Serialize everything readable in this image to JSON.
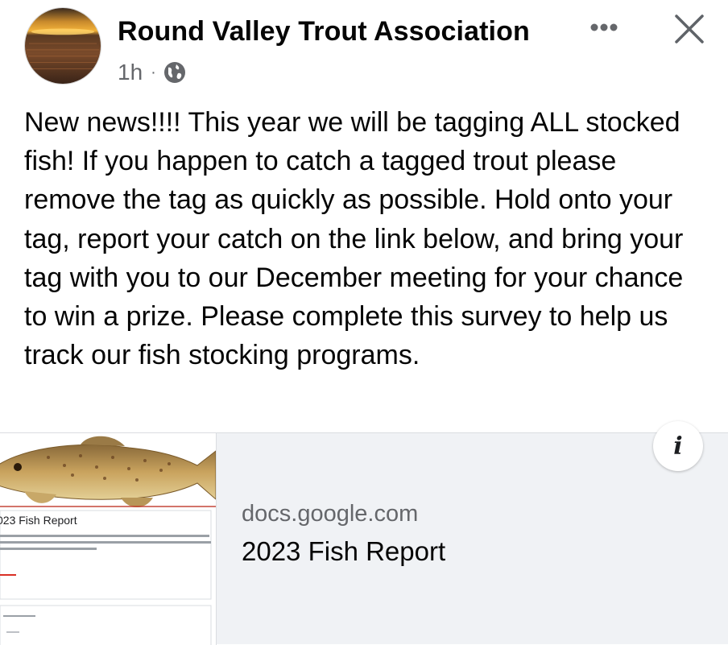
{
  "post": {
    "page_name": "Round Valley Trout Association",
    "timestamp": "1h",
    "separator": "·",
    "privacy_icon": "globe-icon",
    "more_icon": "more-horizontal-icon",
    "close_icon": "close-icon",
    "text": "New news!!!! This year we will be tagging ALL stocked fish! If you happen to catch a tagged trout please remove the tag as quickly as possible. Hold onto your tag, report your catch on the link below, and bring your tag with you to our December meeting for your chance to win a prize. Please complete this survey to help us track our fish stocking programs."
  },
  "link_preview": {
    "domain": "docs.google.com",
    "title": "2023 Fish Report",
    "thumbnail_title": "023 Fish Report",
    "info_icon": "info-icon",
    "info_label": "i"
  },
  "colors": {
    "text_primary": "#050505",
    "text_secondary": "#65676b",
    "card_background": "#f0f2f5"
  }
}
